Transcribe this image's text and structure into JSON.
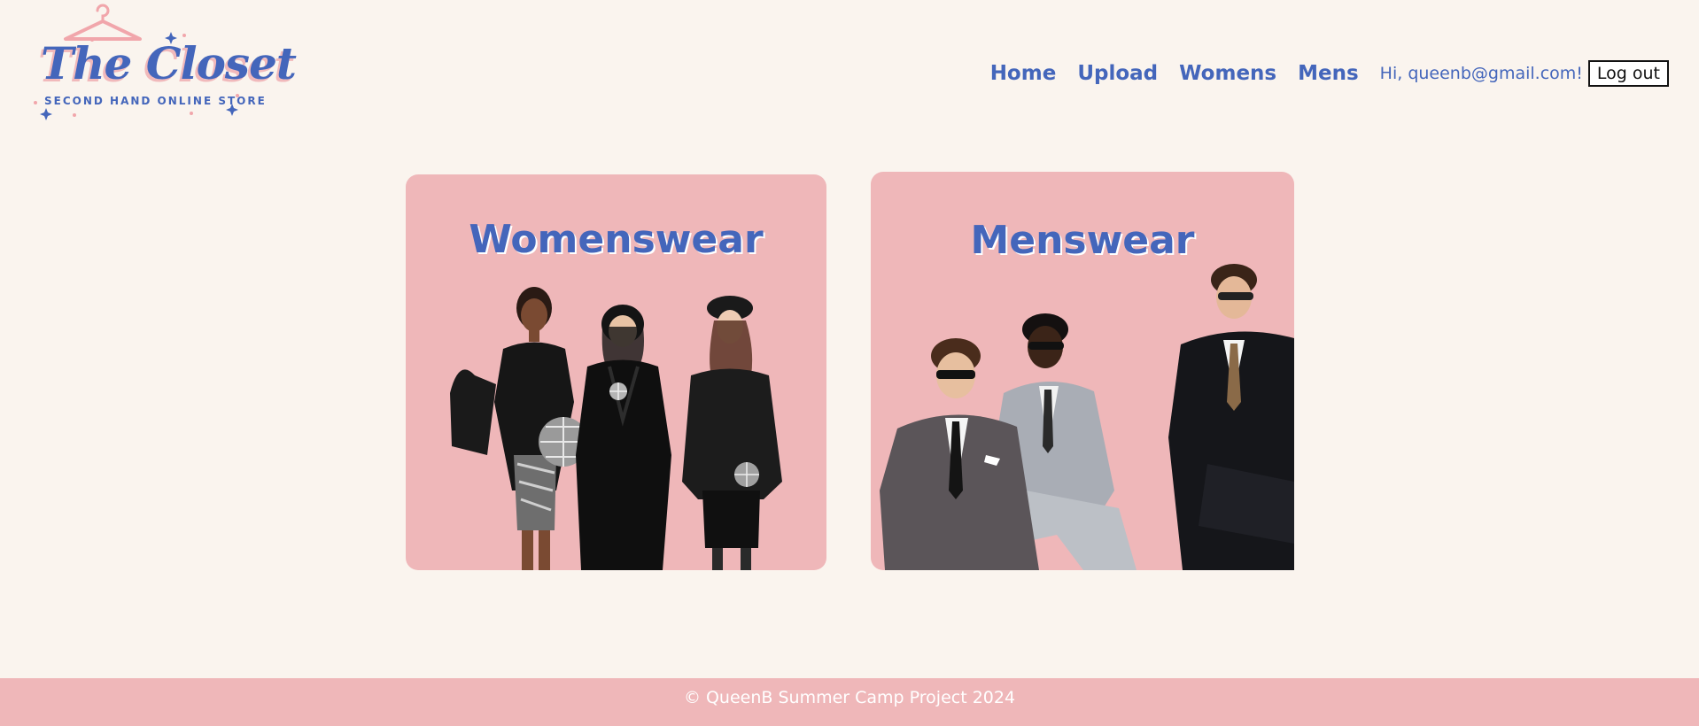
{
  "brand": {
    "title": "The Closet",
    "subtitle": "SECOND HAND ONLINE STORE",
    "icon": "hanger-icon"
  },
  "nav": {
    "home": "Home",
    "upload": "Upload",
    "womens": "Womens",
    "mens": "Mens",
    "greeting": "Hi, queenb@gmail.com!",
    "logout": "Log out"
  },
  "cards": {
    "womens": {
      "title": "Womenswear"
    },
    "mens": {
      "title": "Menswear"
    }
  },
  "footer": {
    "text": "© QueenB Summer Camp Project 2024"
  },
  "colors": {
    "background": "#faf4ee",
    "accent_blue": "#4466bb",
    "pink": "#efb7b9"
  }
}
